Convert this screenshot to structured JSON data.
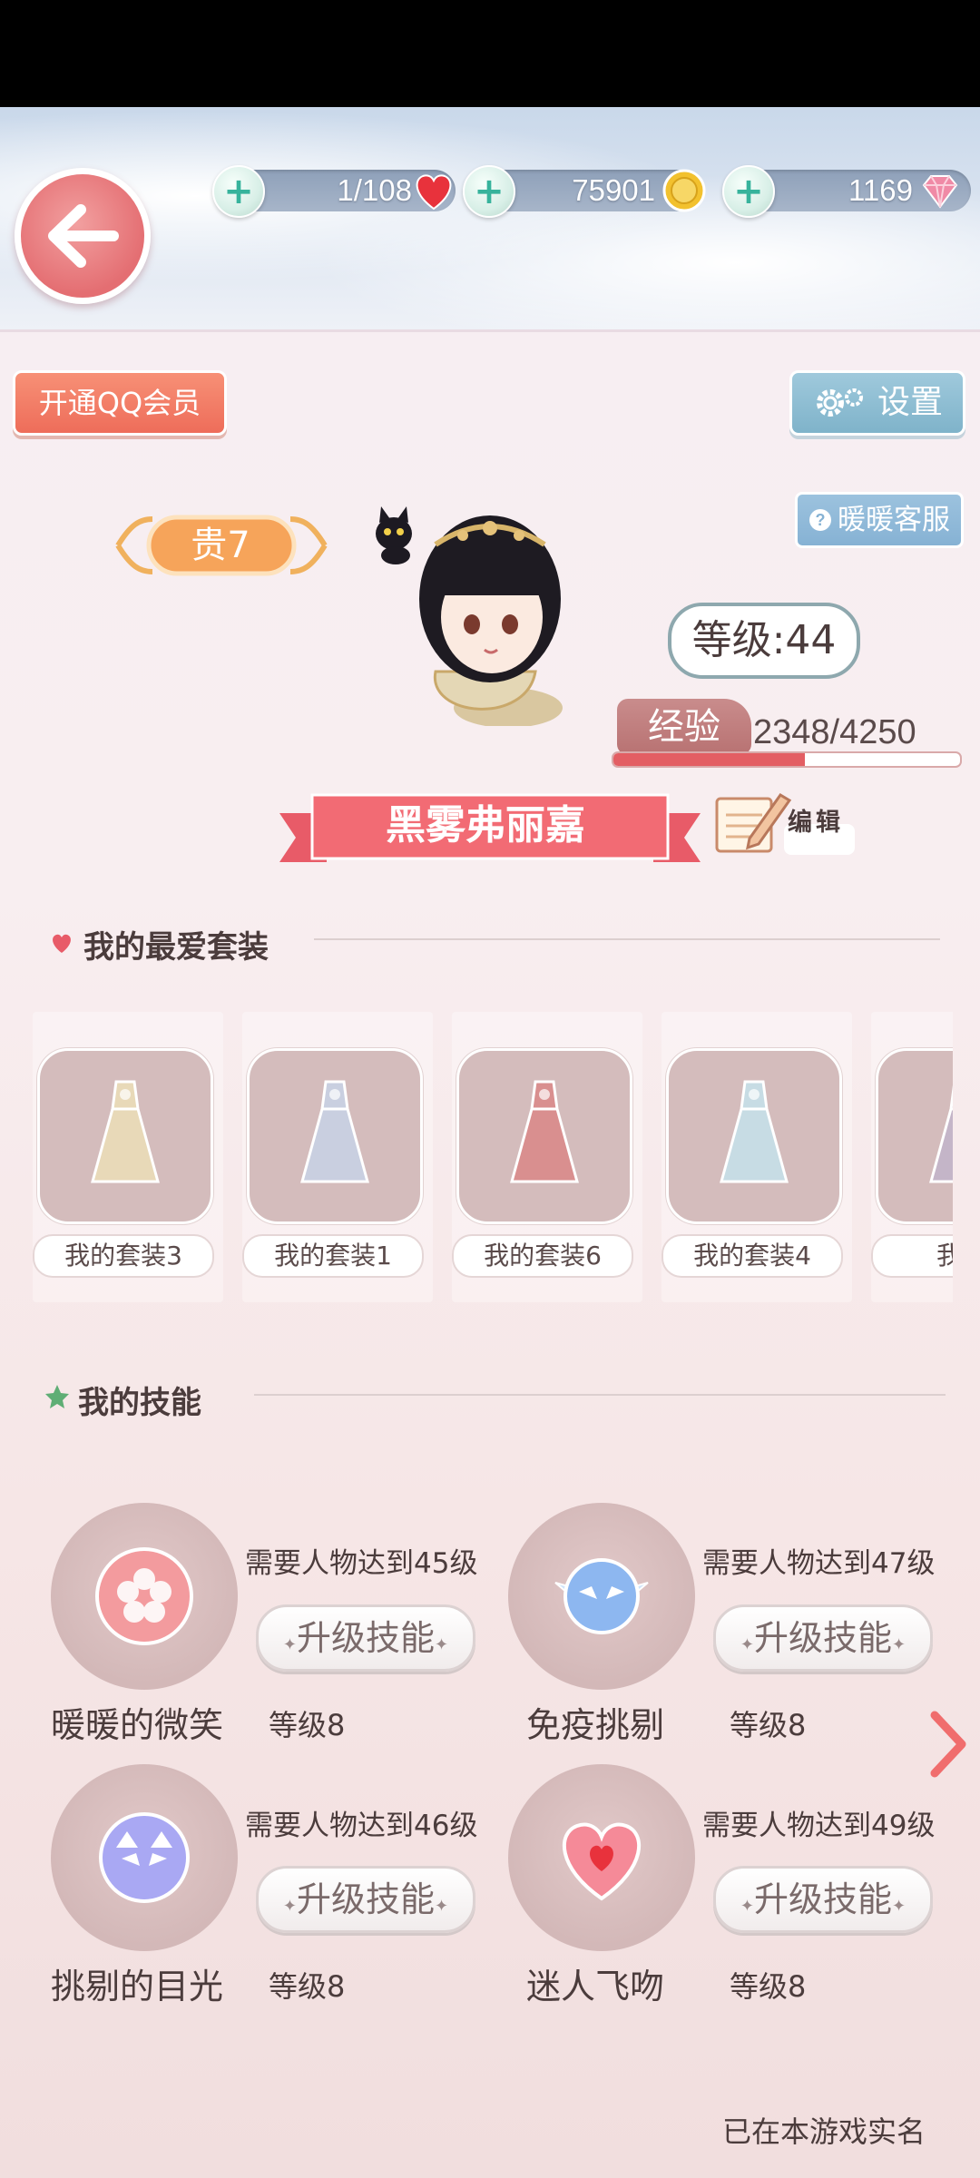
{
  "resources": {
    "stamina": "1/108",
    "gold": "75901",
    "diamond": "1169"
  },
  "top_buttons": {
    "qq_vip": "开通QQ会员",
    "settings": "设置",
    "service": "暖暖客服"
  },
  "profile": {
    "vip_level": "贵7",
    "level": "等级:44",
    "exp_label": "经验",
    "exp_value": "2348/4250",
    "exp_progress": 0.552,
    "name": "黑雾弗丽嘉",
    "edit_label": "编辑"
  },
  "favorites": {
    "title": "我的最爱套装",
    "items": [
      {
        "label": "我的套装3",
        "color": "#e8d9b8"
      },
      {
        "label": "我的套装1",
        "color": "#c9cfe0"
      },
      {
        "label": "我的套装6",
        "color": "#d98f8f"
      },
      {
        "label": "我的套装4",
        "color": "#c7dce4"
      },
      {
        "label": "我的",
        "color": "#c4b5c8"
      }
    ]
  },
  "skills": {
    "title": "我的技能",
    "items": [
      {
        "name": "暖暖的微笑",
        "requirement": "需要人物达到45级",
        "upgrade": "升级技能",
        "level": "等级8",
        "icon": "flower-icon"
      },
      {
        "name": "免疫挑剔",
        "requirement": "需要人物达到47级",
        "upgrade": "升级技能",
        "level": "等级8",
        "icon": "winged-mask-icon"
      },
      {
        "name": "挑剔的目光",
        "requirement": "需要人物达到46级",
        "upgrade": "升级技能",
        "level": "等级8",
        "icon": "cat-mask-icon"
      },
      {
        "name": "迷人飞吻",
        "requirement": "需要人物达到49级",
        "upgrade": "升级技能",
        "level": "等级8",
        "icon": "heart-icon"
      }
    ]
  },
  "footer": {
    "realname": "已在本游戏实名"
  },
  "colors": {
    "accent_red": "#e46e72",
    "settings_blue": "#7fb3ca",
    "vip_orange": "#f6a45a",
    "exp_fill": "#e35e63"
  }
}
